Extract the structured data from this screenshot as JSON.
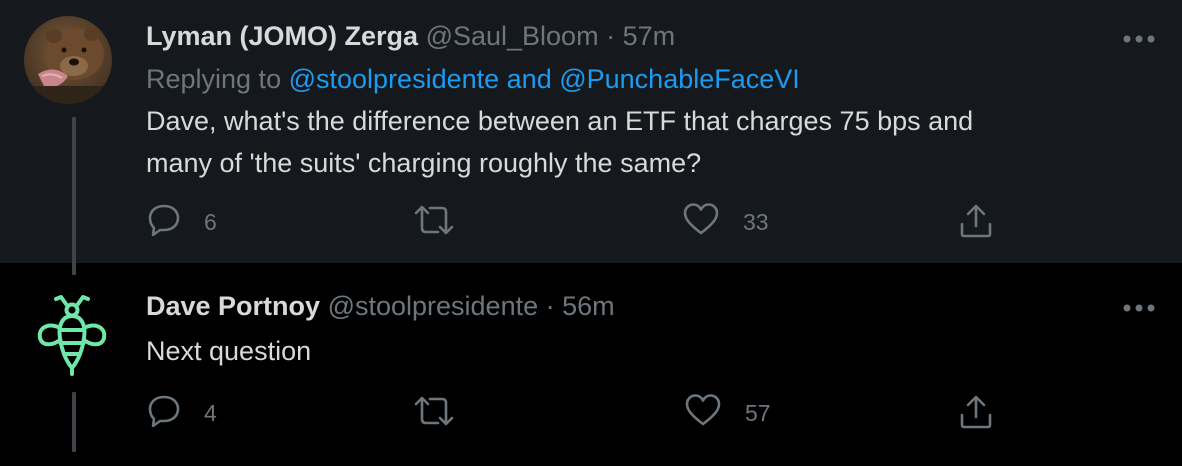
{
  "tweets": [
    {
      "display_name": "Lyman (JOMO) Zerga",
      "handle": "@Saul_Bloom",
      "separator": "·",
      "time": "57m",
      "replying_prefix": "Replying to",
      "mention_1": "@stoolpresidente",
      "mention_joiner": "and",
      "mention_2": "@PunchableFaceVI",
      "text_line_1": "Dave, what's the difference between an ETF that charges 75 bps and",
      "text_line_2": "many of 'the suits' charging roughly the same?",
      "reply_count": "6",
      "like_count": "33",
      "avatar_icon": "bear-with-salmon-photo"
    },
    {
      "display_name": "Dave Portnoy",
      "handle": "@stoolpresidente",
      "separator": "·",
      "time": "56m",
      "text_line_1": "Next question",
      "reply_count": "4",
      "like_count": "57",
      "avatar_icon": "firefly-logo"
    }
  ],
  "icons": [
    "more-icon",
    "reply-icon",
    "retweet-icon",
    "like-icon",
    "share-icon"
  ],
  "colors": {
    "background_highlight": "#15181c",
    "background": "#000000",
    "text": "#d9d9d9",
    "muted": "#6e767d",
    "link": "#1d9bf0",
    "logo_green": "#6ee7a8"
  }
}
